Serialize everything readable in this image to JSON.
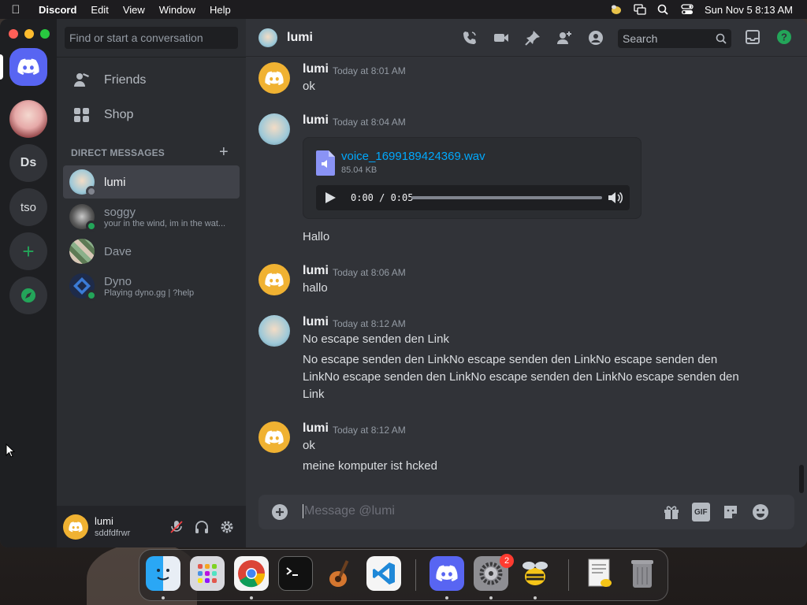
{
  "menubar": {
    "app": "Discord",
    "menus": [
      "Edit",
      "View",
      "Window",
      "Help"
    ],
    "clock": "Sun Nov 5  8:13 AM"
  },
  "servers": {
    "ds_label": "Ds",
    "tso_label": "tso"
  },
  "dm_sidebar": {
    "search_placeholder": "Find or start a conversation",
    "nav": {
      "friends": "Friends",
      "shop": "Shop"
    },
    "header": "DIRECT MESSAGES",
    "dms": [
      {
        "name": "lumi",
        "sub": ""
      },
      {
        "name": "soggy",
        "sub": "your in the wind, im in the wat..."
      },
      {
        "name": "Dave",
        "sub": ""
      },
      {
        "name": "Dyno",
        "sub": "Playing dyno.gg | ?help"
      }
    ]
  },
  "user_panel": {
    "name": "lumi",
    "tag": "sddfdfrwr"
  },
  "chat": {
    "recipient": "lumi",
    "search_placeholder": "Search",
    "composer_placeholder": "Message @lumi",
    "composer_gif": "GIF",
    "messages": [
      {
        "author": "lumi",
        "time": "Today at 8:01 AM",
        "lines": [
          "ok"
        ]
      },
      {
        "author": "lumi",
        "time": "Today at 8:04 AM",
        "lines": [
          "Hallo"
        ]
      },
      {
        "author": "lumi",
        "time": "Today at 8:06 AM",
        "lines": [
          "hallo"
        ]
      },
      {
        "author": "lumi",
        "time": "Today at 8:12 AM",
        "lines": [
          "No escape senden den Link",
          "No escape senden den LinkNo escape senden den LinkNo escape senden den LinkNo escape senden den LinkNo escape senden den LinkNo escape senden den Link"
        ]
      },
      {
        "author": "lumi",
        "time": "Today at 8:12 AM",
        "lines": [
          "ok",
          "meine komputer ist hcked"
        ]
      }
    ],
    "attachment": {
      "file_name": "voice_1699189424369.wav",
      "file_size": "85.04 KB",
      "time_display": "0:00 / 0:05",
      "progress": 0
    }
  },
  "dock": {
    "apps": [
      "finder-icon",
      "launchpad-icon",
      "chrome-icon",
      "terminal-icon",
      "garageband-icon",
      "vscode-icon",
      "discord-icon",
      "system-settings-icon",
      "cyberduck-icon",
      "preview-icon",
      "trash-icon"
    ],
    "settings_badge": "2"
  },
  "colors": {
    "blurple": "#5865f2",
    "green": "#23a559",
    "link": "#00a8fc",
    "bot_yellow": "#f0b232"
  }
}
